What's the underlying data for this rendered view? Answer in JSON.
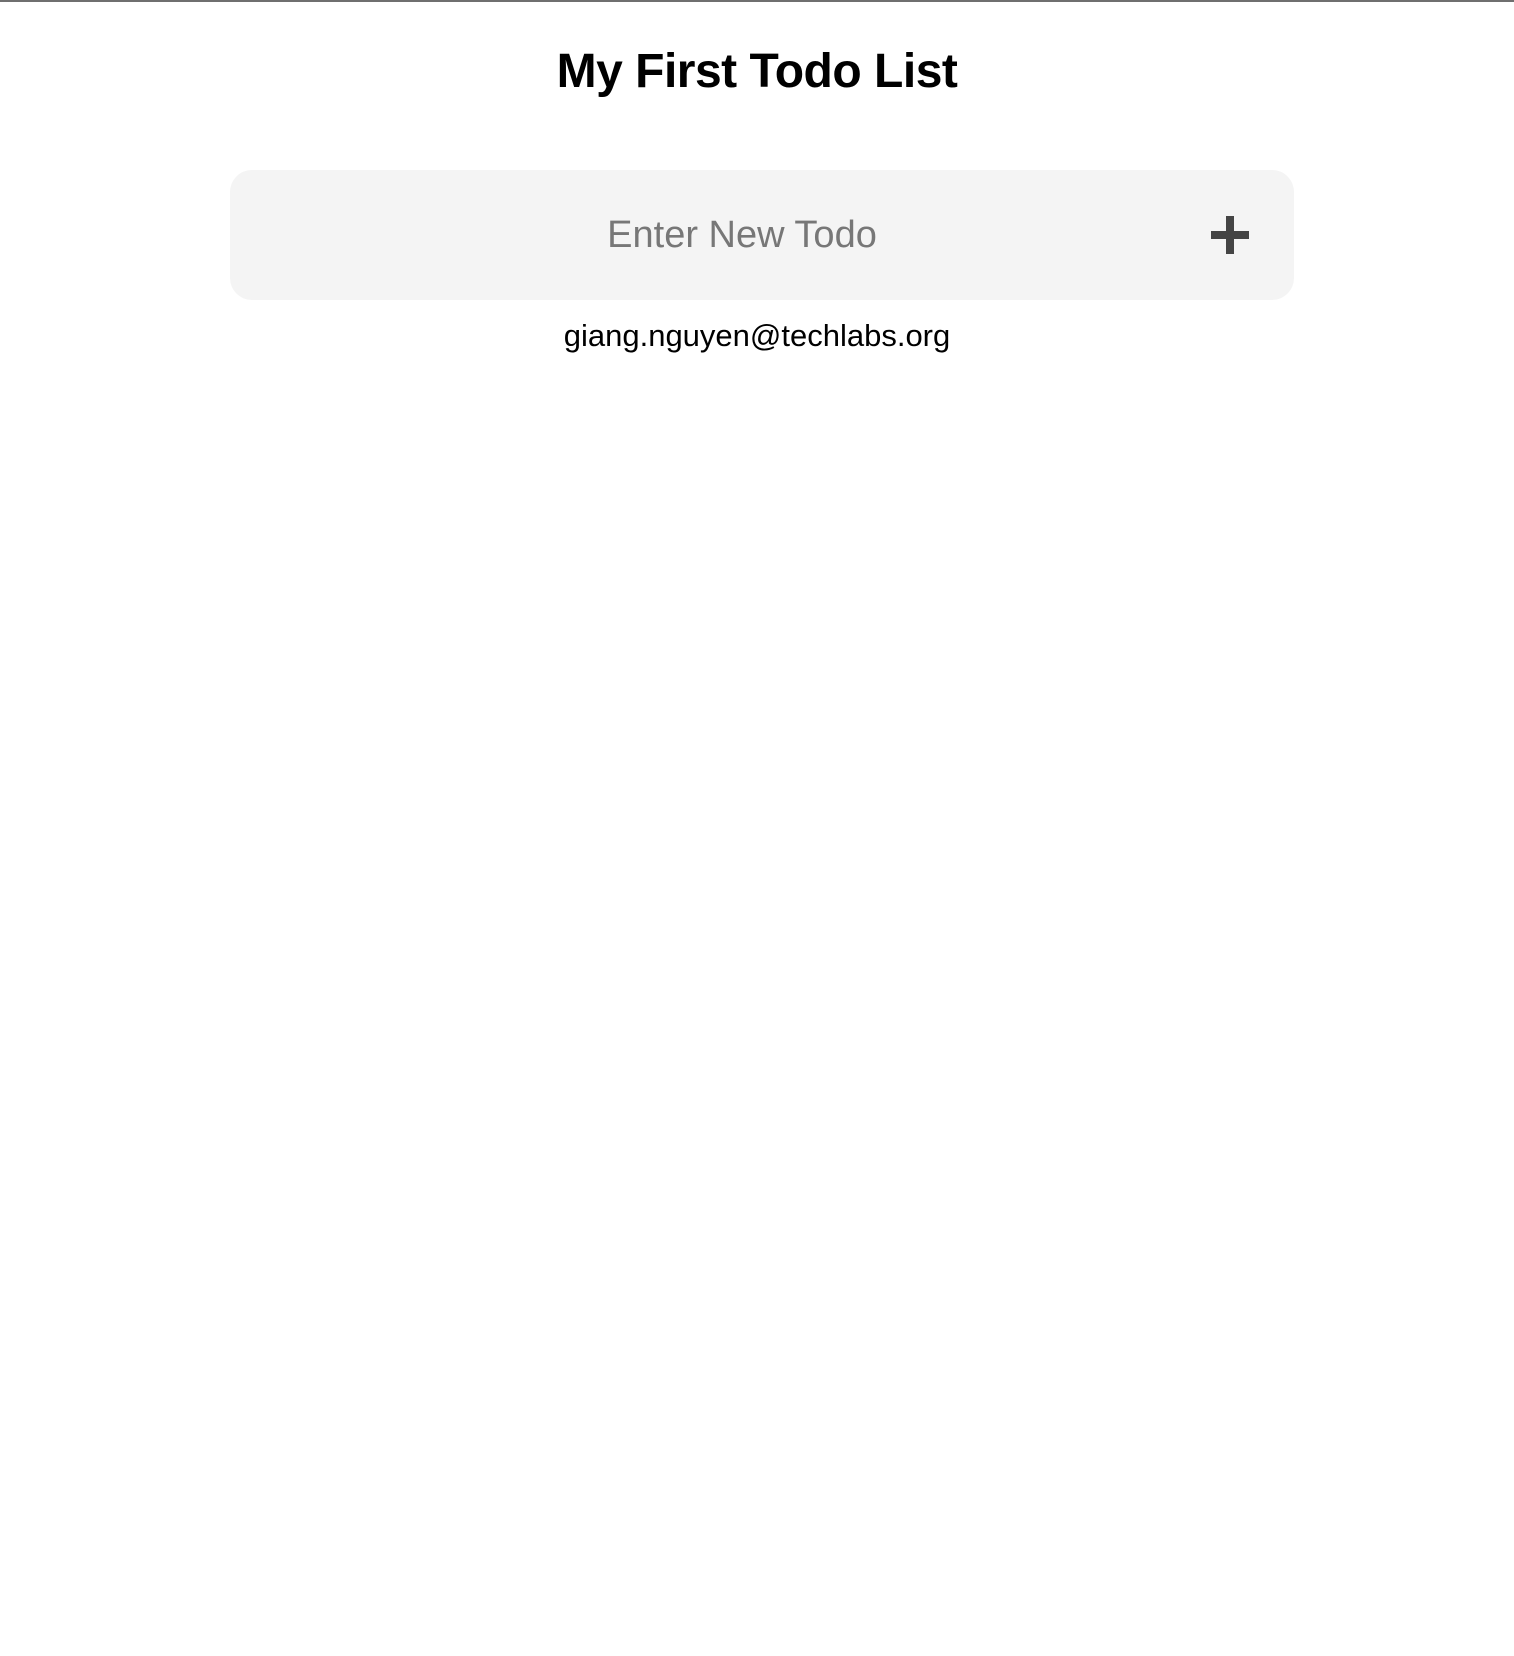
{
  "page": {
    "title": "My First Todo List"
  },
  "todo_form": {
    "input_value": "",
    "input_placeholder": "Enter New Todo",
    "add_icon": "plus-icon"
  },
  "user": {
    "email": "giang.nguyen@techlabs.org"
  },
  "colors": {
    "background": "#ffffff",
    "input_background": "#f4f4f4",
    "placeholder_text": "#777777",
    "icon": "#444444",
    "text": "#000000"
  }
}
